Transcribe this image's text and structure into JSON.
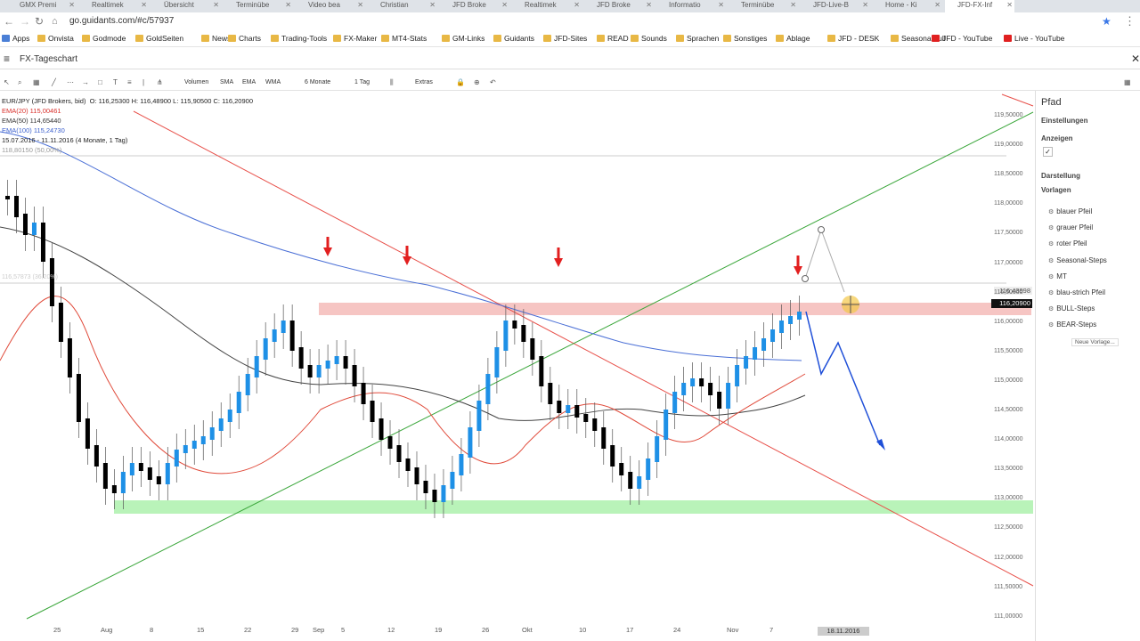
{
  "browser": {
    "tabs": [
      "GMX Premi",
      "Realtimek",
      "Übersicht",
      "Terminübe",
      "Video bea",
      "Christian",
      "JFD Broke",
      "Realtimek",
      "JFD Broke",
      "Informatio",
      "Terminübe",
      "JFD-Live-B",
      "Home - Ki",
      "JFD-FX-Inf"
    ],
    "url": "go.guidants.com/#c/57937",
    "bookmarks": [
      "Apps",
      "Onvista",
      "Godmode",
      "GoldSeiten",
      "News",
      "Charts",
      "Trading-Tools",
      "FX-Maker",
      "MT4-Stats",
      "GM-Links",
      "Guidants",
      "JFD-Sites",
      "READ",
      "Sounds",
      "Sprachen",
      "Sonstiges",
      "Ablage",
      "JFD - DESK",
      "SeasonalBull",
      "JFD - YouTube",
      "Live - YouTube"
    ]
  },
  "app": {
    "title": "FX-Tageschart"
  },
  "toolbar": {
    "volumen": "Volumen",
    "sma": "SMA",
    "ema": "EMA",
    "wma": "WMA",
    "period": "6 Monate",
    "interval": "1 Tag",
    "extras": "Extras"
  },
  "legend": {
    "symbol": "EUR/JPY (JFD Brokers, bid)",
    "ohlc": "O: 116,25300  H: 116,48900  L: 115,90500  C: 116,20900",
    "ema20": "EMA(20)  115,00461",
    "ema50": "EMA(50)  114,65440",
    "ema100": "EMA(100)  115,24730",
    "range": "15.07.2016 - 11.11.2016  (4 Monate, 1 Tag)",
    "fib": "118,80150 (50,00%)",
    "fib2": "116,57873 (36,20%)",
    "ema20_color": "#d9302b",
    "ema50_color": "#333333",
    "ema100_color": "#3a5fcd"
  },
  "side": {
    "title": "Pfad",
    "einstellungen": "Einstellungen",
    "anzeigen": "Anzeigen",
    "darstellung": "Darstellung",
    "vorlagen": "Vorlagen",
    "items": [
      "blauer Pfeil",
      "grauer Pfeil",
      "roter Pfeil",
      "Seasonal-Steps",
      "MT",
      "blau-strich Pfeil",
      "BULL-Steps",
      "BEAR-Steps"
    ],
    "new_template": "Neue Vorlage..."
  },
  "chart": {
    "last_price": "116,20900",
    "tag_price": "116,43998",
    "y_ticks": [
      "119,50000",
      "119,00000",
      "118,50000",
      "118,00000",
      "117,50000",
      "117,00000",
      "116,50000",
      "116,00000",
      "115,50000",
      "115,00000",
      "114,50000",
      "114,00000",
      "113,50000",
      "113,00000",
      "112,50000",
      "112,00000",
      "111,50000",
      "111,00000"
    ],
    "x_ticks": [
      "25",
      "Aug",
      "8",
      "15",
      "22",
      "29",
      "Sep",
      "5",
      "12",
      "19",
      "26",
      "Okt",
      "10",
      "17",
      "24",
      "Nov",
      "7"
    ],
    "date_box": "18.11.2016",
    "up_color": "#1e90e6",
    "down_color": "#000000"
  }
}
